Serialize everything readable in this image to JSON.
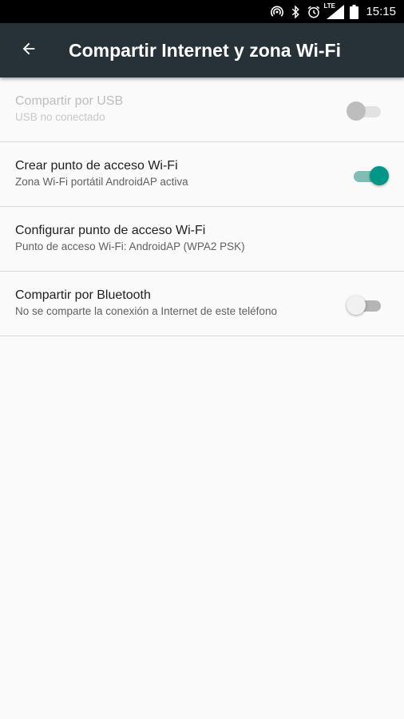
{
  "status_bar": {
    "time": "15:15",
    "network_label": "LTE",
    "icons": [
      "hotspot-icon",
      "bluetooth-icon",
      "alarm-icon",
      "signal-lte-icon",
      "battery-icon"
    ]
  },
  "app_bar": {
    "title": "Compartir Internet y zona Wi-Fi",
    "background_color": "#263238",
    "back_icon": "back-arrow-icon"
  },
  "settings": [
    {
      "id": "usb",
      "title": "Compartir por USB",
      "summary": "USB no conectado",
      "switch": "off",
      "enabled": false
    },
    {
      "id": "hotspot",
      "title": "Crear punto de acceso Wi-Fi",
      "summary": "Zona Wi-Fi portátil AndroidAP activa",
      "switch": "on",
      "enabled": true
    },
    {
      "id": "configure",
      "title": "Configurar punto de acceso Wi-Fi",
      "summary": "Punto de acceso Wi-Fi: AndroidAP (WPA2 PSK)",
      "enabled": true
    },
    {
      "id": "bluetooth",
      "title": "Compartir por Bluetooth",
      "summary": "No se comparte la conexión a Internet de este teléfono",
      "switch": "off",
      "enabled": true
    }
  ],
  "colors": {
    "accent": "#009688",
    "status_bar": "#000000",
    "background": "#fafafa"
  }
}
